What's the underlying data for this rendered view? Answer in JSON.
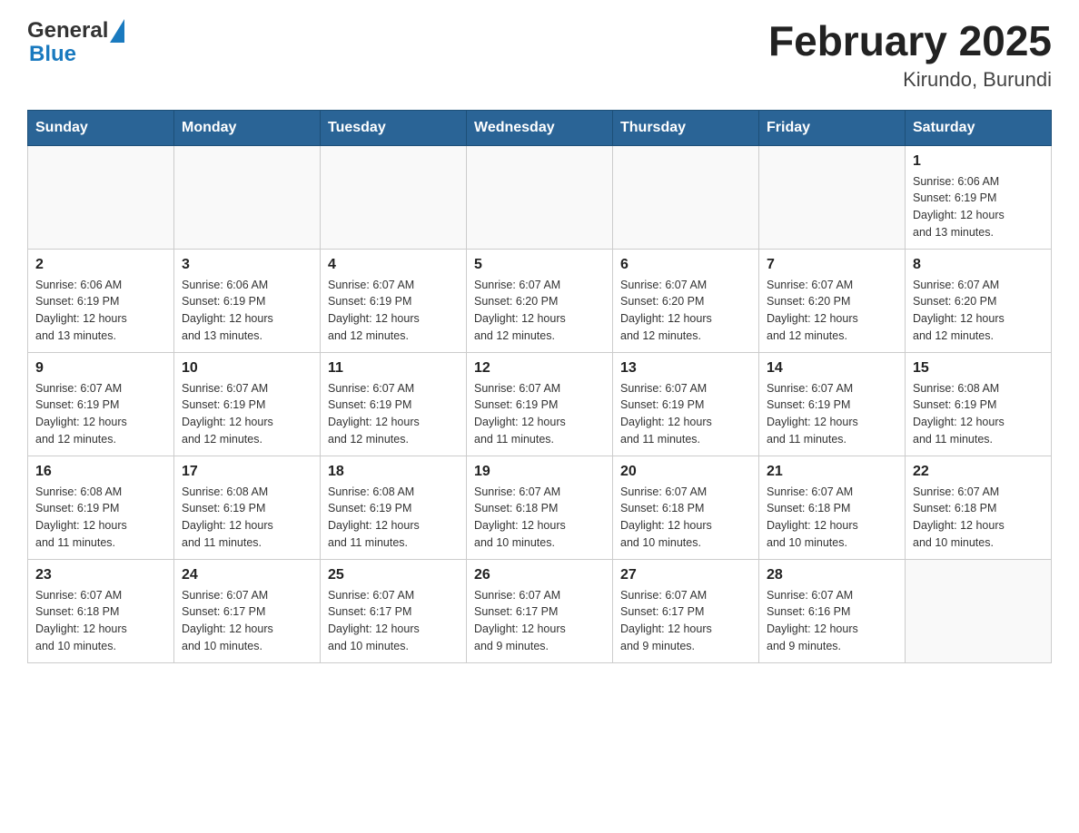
{
  "header": {
    "title": "February 2025",
    "subtitle": "Kirundo, Burundi"
  },
  "logo": {
    "general": "General",
    "blue": "Blue"
  },
  "weekdays": [
    "Sunday",
    "Monday",
    "Tuesday",
    "Wednesday",
    "Thursday",
    "Friday",
    "Saturday"
  ],
  "weeks": [
    [
      {
        "day": "",
        "info": ""
      },
      {
        "day": "",
        "info": ""
      },
      {
        "day": "",
        "info": ""
      },
      {
        "day": "",
        "info": ""
      },
      {
        "day": "",
        "info": ""
      },
      {
        "day": "",
        "info": ""
      },
      {
        "day": "1",
        "info": "Sunrise: 6:06 AM\nSunset: 6:19 PM\nDaylight: 12 hours\nand 13 minutes."
      }
    ],
    [
      {
        "day": "2",
        "info": "Sunrise: 6:06 AM\nSunset: 6:19 PM\nDaylight: 12 hours\nand 13 minutes."
      },
      {
        "day": "3",
        "info": "Sunrise: 6:06 AM\nSunset: 6:19 PM\nDaylight: 12 hours\nand 13 minutes."
      },
      {
        "day": "4",
        "info": "Sunrise: 6:07 AM\nSunset: 6:19 PM\nDaylight: 12 hours\nand 12 minutes."
      },
      {
        "day": "5",
        "info": "Sunrise: 6:07 AM\nSunset: 6:20 PM\nDaylight: 12 hours\nand 12 minutes."
      },
      {
        "day": "6",
        "info": "Sunrise: 6:07 AM\nSunset: 6:20 PM\nDaylight: 12 hours\nand 12 minutes."
      },
      {
        "day": "7",
        "info": "Sunrise: 6:07 AM\nSunset: 6:20 PM\nDaylight: 12 hours\nand 12 minutes."
      },
      {
        "day": "8",
        "info": "Sunrise: 6:07 AM\nSunset: 6:20 PM\nDaylight: 12 hours\nand 12 minutes."
      }
    ],
    [
      {
        "day": "9",
        "info": "Sunrise: 6:07 AM\nSunset: 6:19 PM\nDaylight: 12 hours\nand 12 minutes."
      },
      {
        "day": "10",
        "info": "Sunrise: 6:07 AM\nSunset: 6:19 PM\nDaylight: 12 hours\nand 12 minutes."
      },
      {
        "day": "11",
        "info": "Sunrise: 6:07 AM\nSunset: 6:19 PM\nDaylight: 12 hours\nand 12 minutes."
      },
      {
        "day": "12",
        "info": "Sunrise: 6:07 AM\nSunset: 6:19 PM\nDaylight: 12 hours\nand 11 minutes."
      },
      {
        "day": "13",
        "info": "Sunrise: 6:07 AM\nSunset: 6:19 PM\nDaylight: 12 hours\nand 11 minutes."
      },
      {
        "day": "14",
        "info": "Sunrise: 6:07 AM\nSunset: 6:19 PM\nDaylight: 12 hours\nand 11 minutes."
      },
      {
        "day": "15",
        "info": "Sunrise: 6:08 AM\nSunset: 6:19 PM\nDaylight: 12 hours\nand 11 minutes."
      }
    ],
    [
      {
        "day": "16",
        "info": "Sunrise: 6:08 AM\nSunset: 6:19 PM\nDaylight: 12 hours\nand 11 minutes."
      },
      {
        "day": "17",
        "info": "Sunrise: 6:08 AM\nSunset: 6:19 PM\nDaylight: 12 hours\nand 11 minutes."
      },
      {
        "day": "18",
        "info": "Sunrise: 6:08 AM\nSunset: 6:19 PM\nDaylight: 12 hours\nand 11 minutes."
      },
      {
        "day": "19",
        "info": "Sunrise: 6:07 AM\nSunset: 6:18 PM\nDaylight: 12 hours\nand 10 minutes."
      },
      {
        "day": "20",
        "info": "Sunrise: 6:07 AM\nSunset: 6:18 PM\nDaylight: 12 hours\nand 10 minutes."
      },
      {
        "day": "21",
        "info": "Sunrise: 6:07 AM\nSunset: 6:18 PM\nDaylight: 12 hours\nand 10 minutes."
      },
      {
        "day": "22",
        "info": "Sunrise: 6:07 AM\nSunset: 6:18 PM\nDaylight: 12 hours\nand 10 minutes."
      }
    ],
    [
      {
        "day": "23",
        "info": "Sunrise: 6:07 AM\nSunset: 6:18 PM\nDaylight: 12 hours\nand 10 minutes."
      },
      {
        "day": "24",
        "info": "Sunrise: 6:07 AM\nSunset: 6:17 PM\nDaylight: 12 hours\nand 10 minutes."
      },
      {
        "day": "25",
        "info": "Sunrise: 6:07 AM\nSunset: 6:17 PM\nDaylight: 12 hours\nand 10 minutes."
      },
      {
        "day": "26",
        "info": "Sunrise: 6:07 AM\nSunset: 6:17 PM\nDaylight: 12 hours\nand 9 minutes."
      },
      {
        "day": "27",
        "info": "Sunrise: 6:07 AM\nSunset: 6:17 PM\nDaylight: 12 hours\nand 9 minutes."
      },
      {
        "day": "28",
        "info": "Sunrise: 6:07 AM\nSunset: 6:16 PM\nDaylight: 12 hours\nand 9 minutes."
      },
      {
        "day": "",
        "info": ""
      }
    ]
  ]
}
